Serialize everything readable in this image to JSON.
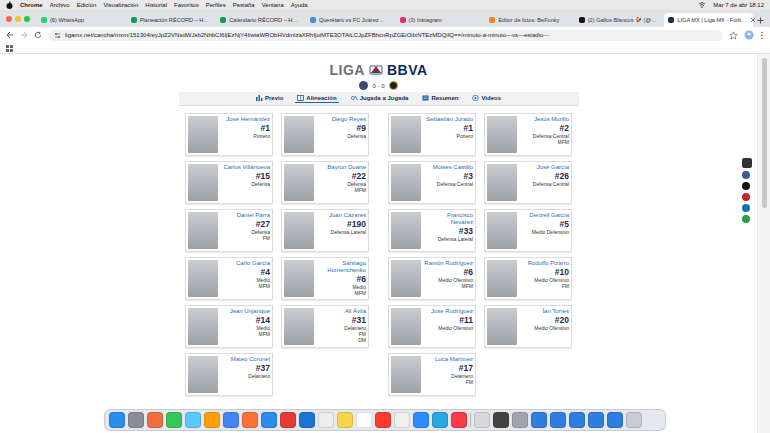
{
  "menubar": {
    "app": "Chrome",
    "items": [
      "Archivo",
      "Edición",
      "Visualización",
      "Historial",
      "Favoritos",
      "Perfiles",
      "Pestaña",
      "Ventana",
      "Ayuda"
    ],
    "clock": "Mar 7 de abr  18:12"
  },
  "tabs": [
    {
      "label": "(6) WhatsApp",
      "selected": false
    },
    {
      "label": "Planeación RÉCORD – H…",
      "selected": false
    },
    {
      "label": "Calendario RÉCORD – H…",
      "selected": false
    },
    {
      "label": "Querétaro vs FC Juárez…",
      "selected": false
    },
    {
      "label": "(3) Instagram",
      "selected": false
    },
    {
      "label": "Editor de fotos: BeFunky",
      "selected": false
    },
    {
      "label": "(2) Gallos Blancos 🐓 (@…",
      "selected": false
    },
    {
      "label": "LIGA MX | Liga MX - Fútb…",
      "selected": true
    }
  ],
  "address": "ligamx.net/cancha/mxm/151304/eyJpZ2VNsdWJsb2NhbCI6IjEzNjY4IiwiaWRObHVdmlzaXRhIjoiMTE3OTAiLCJpZFBhcnRpZGEiOiIxNTEzMDQifQ==/minuto-a-minuto---vs---estadio---",
  "page": {
    "logo_left": "LIGA",
    "logo_right": "BBVA",
    "score": "0 - 0",
    "nav": [
      {
        "label": "Previo",
        "selected": false
      },
      {
        "label": "Alineación",
        "selected": true
      },
      {
        "label": "Jugada a Jugada",
        "selected": false
      },
      {
        "label": "Resumen",
        "selected": false
      },
      {
        "label": "Videos",
        "selected": false
      }
    ]
  },
  "teams": [
    {
      "columns": [
        [
          {
            "name": "José Hernández",
            "number": "#1",
            "lines": [
              "Portero"
            ]
          },
          {
            "name": "Carlos Villanueva",
            "number": "#15",
            "lines": [
              "Defensa"
            ]
          },
          {
            "name": "Daniel Parra",
            "number": "#27",
            "lines": [
              "Defensa",
              "FM"
            ]
          },
          {
            "name": "Carlo García",
            "number": "#4",
            "lines": [
              "Medio",
              "MFM"
            ]
          },
          {
            "name": "Jean Unjanque",
            "number": "#14",
            "lines": [
              "Medio",
              "MFM"
            ]
          },
          {
            "name": "Mateo Coronel",
            "number": "#37",
            "lines": [
              "Delantero"
            ]
          }
        ],
        [
          {
            "name": "Diego Reyes",
            "number": "#9",
            "lines": [
              "Defensa"
            ]
          },
          {
            "name": "Bayron Duarte",
            "number": "#22",
            "lines": [
              "Defensa",
              "MFM"
            ]
          },
          {
            "name": "Juan Cázares",
            "number": "#190",
            "lines": [
              "Defensa Lateral"
            ]
          },
          {
            "name": "Santiago Homenchenko",
            "number": "#6",
            "lines": [
              "Medio",
              "MFM"
            ]
          },
          {
            "name": "Ali Ávila",
            "number": "#31",
            "lines": [
              "Delantero",
              "FM",
              "DM"
            ]
          }
        ]
      ]
    },
    {
      "columns": [
        [
          {
            "name": "Sebastián Jurado",
            "number": "#1",
            "lines": [
              "Portero"
            ]
          },
          {
            "name": "Moises Castillo",
            "number": "#3",
            "lines": [
              "Defensa Central"
            ]
          },
          {
            "name": "Francisco Nevárez",
            "number": "#33",
            "lines": [
              "Defensa Lateral"
            ]
          },
          {
            "name": "Ramón Rodríguez",
            "number": "#6",
            "lines": [
              "Medio Ofensivo",
              "MFM"
            ]
          },
          {
            "name": "Jose Rodríguez",
            "number": "#11",
            "lines": [
              "Medio Ofensivo"
            ]
          },
          {
            "name": "Luca Martínez",
            "number": "#17",
            "lines": [
              "Delantero",
              "FM"
            ]
          }
        ],
        [
          {
            "name": "Jesús Murillo",
            "number": "#2",
            "lines": [
              "Defensa Central",
              "MFM"
            ]
          },
          {
            "name": "José García",
            "number": "#26",
            "lines": [
              "Defensa Central"
            ]
          },
          {
            "name": "Denzell García",
            "number": "#5",
            "lines": [
              "Medio Defensivo"
            ]
          },
          {
            "name": "Rodolfo Pizarro",
            "number": "#10",
            "lines": [
              "Medio Ofensivo",
              "FM"
            ]
          },
          {
            "name": "Ían Torres",
            "number": "#20",
            "lines": [
              "Medio Ofensivo"
            ]
          }
        ]
      ]
    }
  ]
}
